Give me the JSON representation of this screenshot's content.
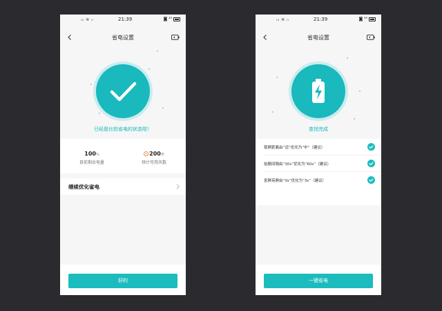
{
  "status_bar": {
    "signal": "ᵢᵢᵢ ≋ ᵢᵢ",
    "time": "21:39",
    "right": "◙ ⁴⁵"
  },
  "left": {
    "title": "省电设置",
    "hero_text": "已经是比较省电的状态啦！",
    "stats": {
      "remaining": {
        "value": "100",
        "unit": "%",
        "label": "目前剩余电量"
      },
      "days": {
        "value": "200",
        "unit": "天",
        "label": "预计可用天数"
      }
    },
    "continue_label": "继续优化省电",
    "button_label": "好的"
  },
  "right": {
    "title": "省电设置",
    "hero_text": "查找完成",
    "options": [
      {
        "text": "锁屏距离由“远”优化为“中”（建议）"
      },
      {
        "text": "抬腕间隔由“30s”优化为“60s”（建议）"
      },
      {
        "text": "息屏亮屏由“0s”优化为“3s”（建议）"
      }
    ],
    "button_label": "一键省电"
  },
  "colors": {
    "accent": "#1cbcbe",
    "background": "#2b2b2f",
    "screen": "#f6f6f6"
  },
  "icons": {
    "back": "chevron-left-icon",
    "battery_mode": "battery-outline-icon",
    "success": "check-icon",
    "battery_charge": "battery-bolt-icon",
    "time": "clock-icon",
    "row_more": "chevron-right-icon"
  }
}
